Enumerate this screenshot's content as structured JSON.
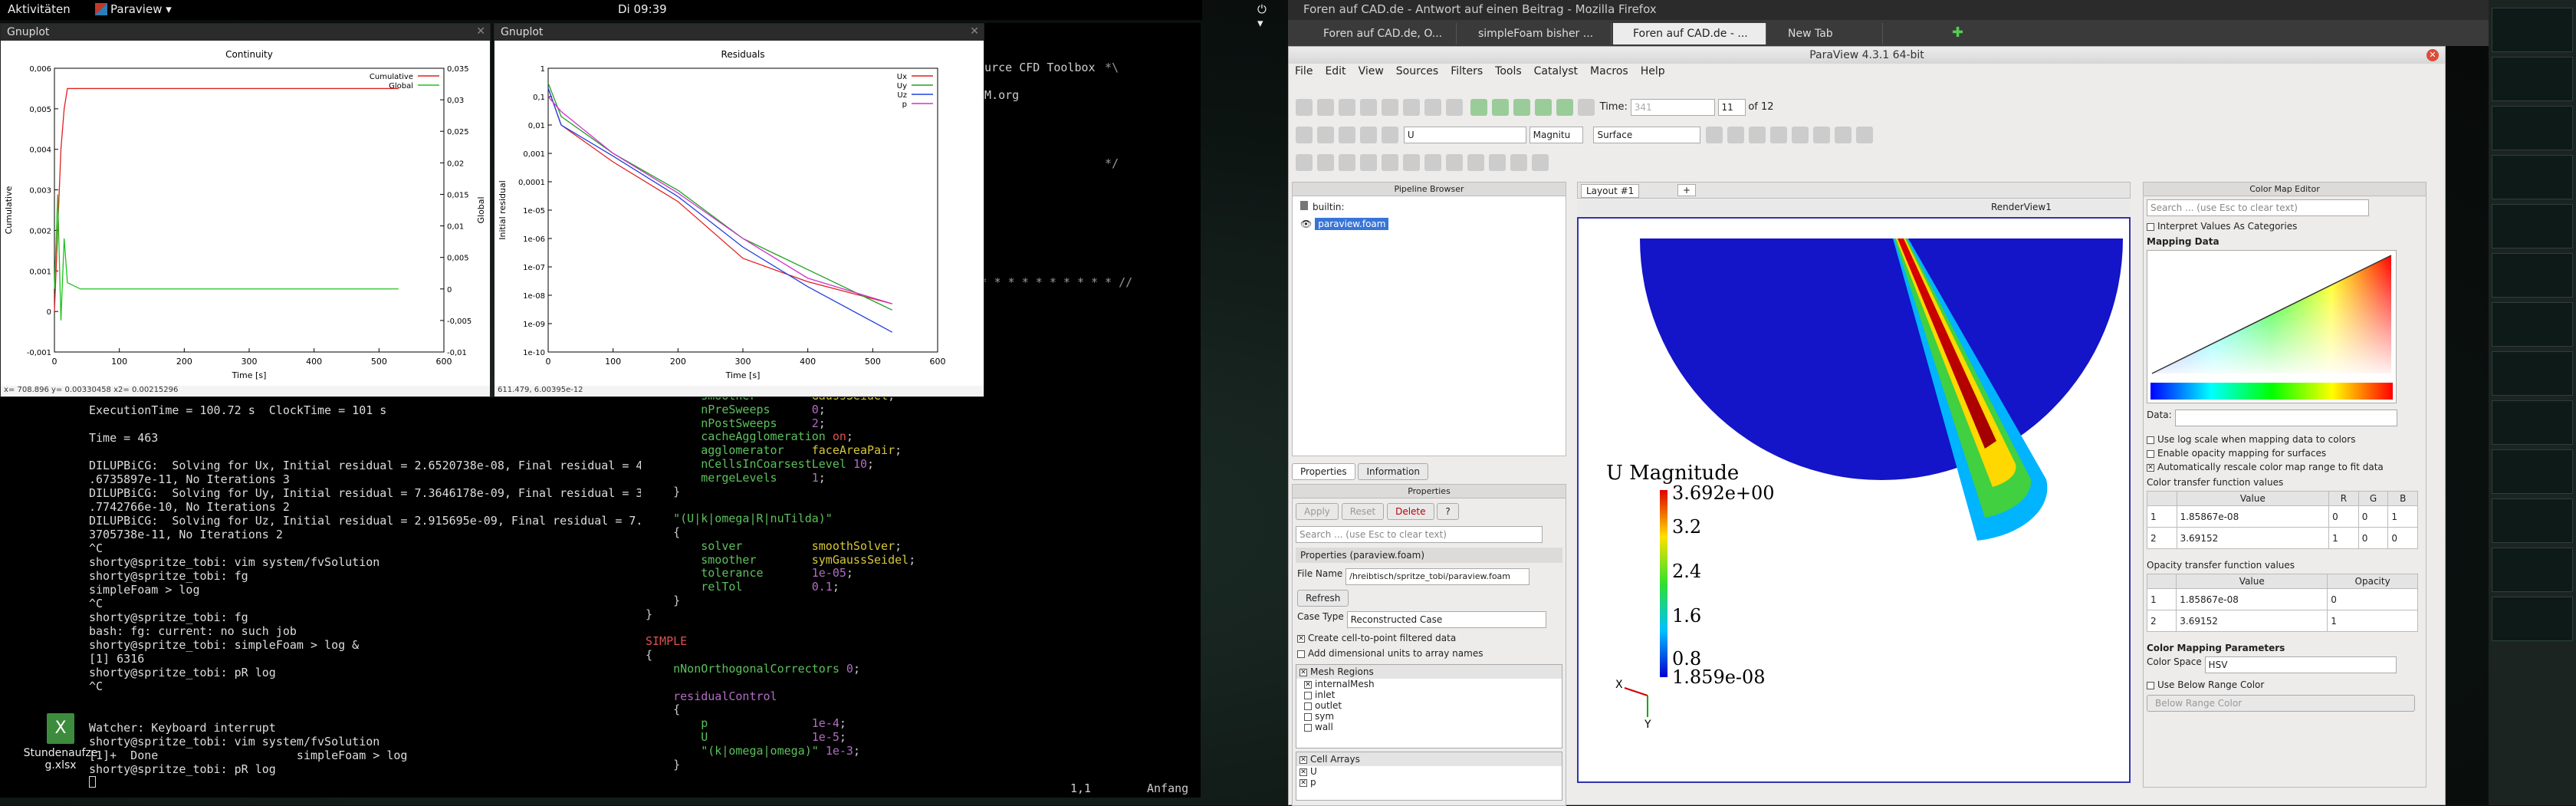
{
  "topbar": {
    "activities": "Aktivitäten",
    "app": "Paraview ▾",
    "clock": "Di 09:39"
  },
  "gnuplot1": {
    "title": "Gnuplot",
    "status": "x= 708.896 y= 0.00330458 x2= 0.00215296"
  },
  "gnuplot2": {
    "title": "Gnuplot",
    "status": "611.479,  6.00395e-12"
  },
  "chart_data": [
    {
      "type": "line",
      "title": "Continuity",
      "xlabel": "Time [s]",
      "ylabel": "Cumulative",
      "y2label": "Global",
      "xlim": [
        0,
        600
      ],
      "ylim": [
        -0.001,
        0.006
      ],
      "y2lim": [
        -0.01,
        0.035
      ],
      "x_ticks": [
        "0",
        "100",
        "200",
        "300",
        "400",
        "500",
        "600"
      ],
      "y_ticks": [
        "-0,001",
        "0",
        "0,001",
        "0,002",
        "0,003",
        "0,004",
        "0,005",
        "0,006"
      ],
      "y2_ticks": [
        "-0,01",
        "-0,005",
        "0",
        "0,005",
        "0,01",
        "0,015",
        "0,02",
        "0,025",
        "0,03",
        "0,035"
      ],
      "series": [
        {
          "name": "Cumulative",
          "color": "#e02020",
          "x": [
            0,
            5,
            10,
            15,
            20,
            30,
            50,
            80,
            150,
            300,
            530
          ],
          "y": [
            0.0,
            0.002,
            0.004,
            0.005,
            0.0055,
            0.0055,
            0.0055,
            0.0055,
            0.0055,
            0.0055,
            0.0055
          ]
        },
        {
          "name": "Global",
          "color": "#20c020",
          "x": [
            0,
            5,
            10,
            15,
            20,
            30,
            40,
            60,
            100,
            300,
            530
          ],
          "y": [
            0.0,
            0.015,
            -0.005,
            0.008,
            0.001,
            0.0005,
            0.0,
            0.0,
            0.0,
            0.0,
            0.0
          ]
        }
      ]
    },
    {
      "type": "line",
      "title": "Residuals",
      "xlabel": "Time [s]",
      "ylabel": "Initial residual",
      "log_y": true,
      "xlim": [
        0,
        600
      ],
      "ylim": [
        1e-10,
        1
      ],
      "x_ticks": [
        "0",
        "100",
        "200",
        "300",
        "400",
        "500",
        "600"
      ],
      "y_ticks": [
        "1",
        "0,1",
        "0,01",
        "0,001",
        "0,0001",
        "1e-05",
        "1e-06",
        "1e-07",
        "1e-08",
        "1e-09",
        "1e-10"
      ],
      "series": [
        {
          "name": "Ux",
          "color": "#e02020",
          "x": [
            0,
            20,
            100,
            200,
            300,
            400,
            530
          ],
          "y": [
            0.2,
            0.01,
            0.0005,
            2e-05,
            2e-07,
            3e-08,
            5e-09
          ]
        },
        {
          "name": "Uy",
          "color": "#20a020",
          "x": [
            0,
            20,
            100,
            200,
            300,
            400,
            530
          ],
          "y": [
            0.3,
            0.02,
            0.001,
            5e-05,
            1e-06,
            8e-08,
            3e-09
          ]
        },
        {
          "name": "Uz",
          "color": "#2040e0",
          "x": [
            0,
            20,
            100,
            200,
            300,
            400,
            530
          ],
          "y": [
            0.2,
            0.01,
            0.0008,
            3e-05,
            5e-07,
            2e-08,
            5e-10
          ]
        },
        {
          "name": "p",
          "color": "#d030d0",
          "x": [
            0,
            20,
            100,
            200,
            300,
            400,
            530
          ],
          "y": [
            0.1,
            0.03,
            0.001,
            4e-05,
            1e-06,
            4e-08,
            5e-09
          ]
        }
      ]
    }
  ],
  "terminal": {
    "lines": [
      "ExecutionTime = 100.72 s  ClockTime = 101 s",
      "",
      "Time = 463",
      "",
      "DILUPBiCG:  Solving for Ux, Initial residual = 2.6520738e-08, Final residual = 4",
      ".6735897e-11, No Iterations 3",
      "DILUPBiCG:  Solving for Uy, Initial residual = 7.3646178e-09, Final residual = 3",
      ".7742766e-10, No Iterations 2",
      "DILUPBiCG:  Solving for Uz, Initial residual = 2.915695e-09, Final residual = 7.",
      "3705738e-11, No Iterations 2",
      "^C",
      "shorty@spritze_tobi: vim system/fvSolution",
      "shorty@spritze_tobi: fg",
      "simpleFoam > log",
      "^C",
      "shorty@spritze_tobi: fg",
      "bash: fg: current: no such job",
      "shorty@spritze_tobi: simpleFoam > log &",
      "[1] 6316",
      "shorty@spritze_tobi: pR log",
      "^C",
      "",
      "",
      "Watcher: Keyboard interrupt",
      "shorty@spritze_tobi: vim system/fvSolution",
      "[1]+  Done                    simpleFoam > log",
      "shorty@spritze_tobi: pR log"
    ]
  },
  "vim": {
    "head1": "Source CFD Toolbox",
    "head2": "OAM.org",
    "status_pos": "1,1",
    "status_where": "Anfang"
  },
  "desktop_icon": {
    "label1": "Stundenaufze",
    "label2": "g.xlsx",
    "icon": "X"
  },
  "firefox": {
    "title": "Foren auf CAD.de - Antwort auf einen Beitrag - Mozilla Firefox",
    "tabs": [
      "Foren auf CAD.de, O...",
      "simpleFoam bisher ...",
      "Foren auf CAD.de - ...",
      "New Tab"
    ]
  },
  "paraview": {
    "title": "ParaView 4.3.1 64-bit",
    "menu": [
      "File",
      "Edit",
      "View",
      "Sources",
      "Filters",
      "Tools",
      "Catalyst",
      "Macros",
      "Help"
    ],
    "time_label": "Time:",
    "time_value": "341",
    "step_value": "11",
    "of_steps": "of 12",
    "array": "U",
    "mode": "Magnitu",
    "repr": "Surface",
    "pipeline": {
      "title": "Pipeline Browser",
      "builtin": "builtin:",
      "source": "paraview.foam"
    },
    "tabs": {
      "properties": "Properties",
      "information": "Information"
    },
    "props": {
      "title": "Properties",
      "apply": "Apply",
      "reset": "Reset",
      "delete": "Delete",
      "help": "?",
      "search": "Search ... (use Esc to clear text)",
      "group": "Properties (paraview.foam)",
      "file_name_label": "File Name",
      "file_name": "/hreibtisch/spritze_tobi/paraview.foam",
      "refresh": "Refresh",
      "case_type_label": "Case Type",
      "case_type": "Reconstructed Case",
      "cell_to_point": "Create cell-to-point filtered data",
      "dim_units": "Add dimensional units to array names",
      "mesh_regions": "Mesh Regions",
      "regions": [
        "internalMesh",
        "inlet",
        "outlet",
        "sym",
        "wall"
      ],
      "cell_arrays": "Cell Arrays",
      "arrays": [
        "U",
        "p"
      ]
    },
    "layout": {
      "tab": "Layout #1",
      "view": "RenderView1"
    },
    "legend": {
      "title": "U Magnitude",
      "labels": [
        "3.692e+00",
        "3.2",
        "2.4",
        "1.6",
        "0.8",
        "1.859e-08"
      ]
    },
    "axes": {
      "x": "X",
      "y": "Y"
    },
    "cme": {
      "title": "Color Map Editor",
      "search": "Search ... (use Esc to clear text)",
      "interpret": "Interpret Values As Categories",
      "mapping": "Mapping Data",
      "data_label": "Data:",
      "log": "Use log scale when mapping data to colors",
      "opacity_map": "Enable opacity mapping for surfaces",
      "rescale": "Automatically rescale color map range to fit data",
      "ctf": "Color transfer function values",
      "ctf_head": [
        "Value",
        "R",
        "G",
        "B"
      ],
      "ctf_rows": [
        [
          "1",
          "1.85867e-08",
          "0",
          "0",
          "1"
        ],
        [
          "2",
          "3.69152",
          "1",
          "0",
          "0"
        ]
      ],
      "otf": "Opacity transfer function values",
      "otf_head": [
        "Value",
        "Opacity"
      ],
      "otf_rows": [
        [
          "1",
          "1.85867e-08",
          "0"
        ],
        [
          "2",
          "3.69152",
          "1"
        ]
      ],
      "params": "Color Mapping Parameters",
      "color_space_label": "Color Space",
      "color_space": "HSV",
      "below": "Use Below Range Color",
      "below_btn": "Below Range Color"
    }
  }
}
